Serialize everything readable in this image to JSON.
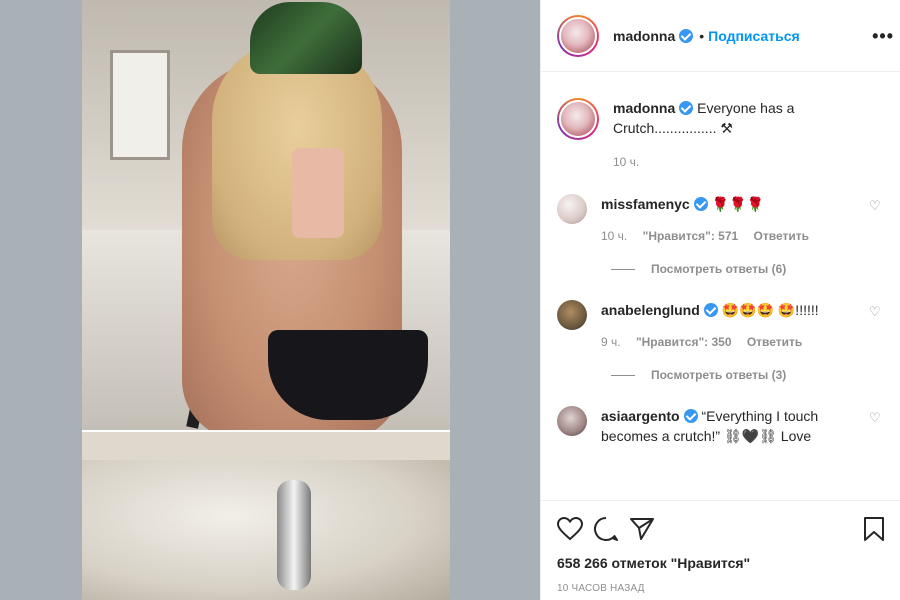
{
  "post_author": {
    "username": "madonna",
    "follow_label": "Подписаться",
    "dot": "•",
    "more": "•••"
  },
  "caption": {
    "username": "madonna",
    "text": "Everyone has a Crutch................ ⚒",
    "time": "10 ч."
  },
  "comments": [
    {
      "username": "missfamenyc",
      "text": "🌹🌹🌹",
      "time": "10 ч.",
      "likes": "\"Нравится\": 571",
      "reply": "Ответить",
      "view_replies": "Посмотреть ответы (6)",
      "verified": true
    },
    {
      "username": "anabelenglund",
      "text": "🤩🤩🤩 🤩!!!!!!",
      "time": "9 ч.",
      "likes": "\"Нравится\": 350",
      "reply": "Ответить",
      "view_replies": "Посмотреть ответы (3)",
      "verified": true
    },
    {
      "username": "asiaargento",
      "text": "“Everything I touch becomes a crutch!” ⛓🖤⛓ Love",
      "verified": true
    }
  ],
  "actions": {
    "icons": [
      "heart-icon",
      "comment-icon",
      "share-icon",
      "bookmark-icon"
    ],
    "likes_text": "658 266 отметок \"Нравится\"",
    "posted_time": "10 ЧАСОВ НАЗАД"
  },
  "colors": {
    "accent": "#0095f6",
    "verified": "#3897f0",
    "muted": "#8e8e8e",
    "text": "#262626"
  }
}
